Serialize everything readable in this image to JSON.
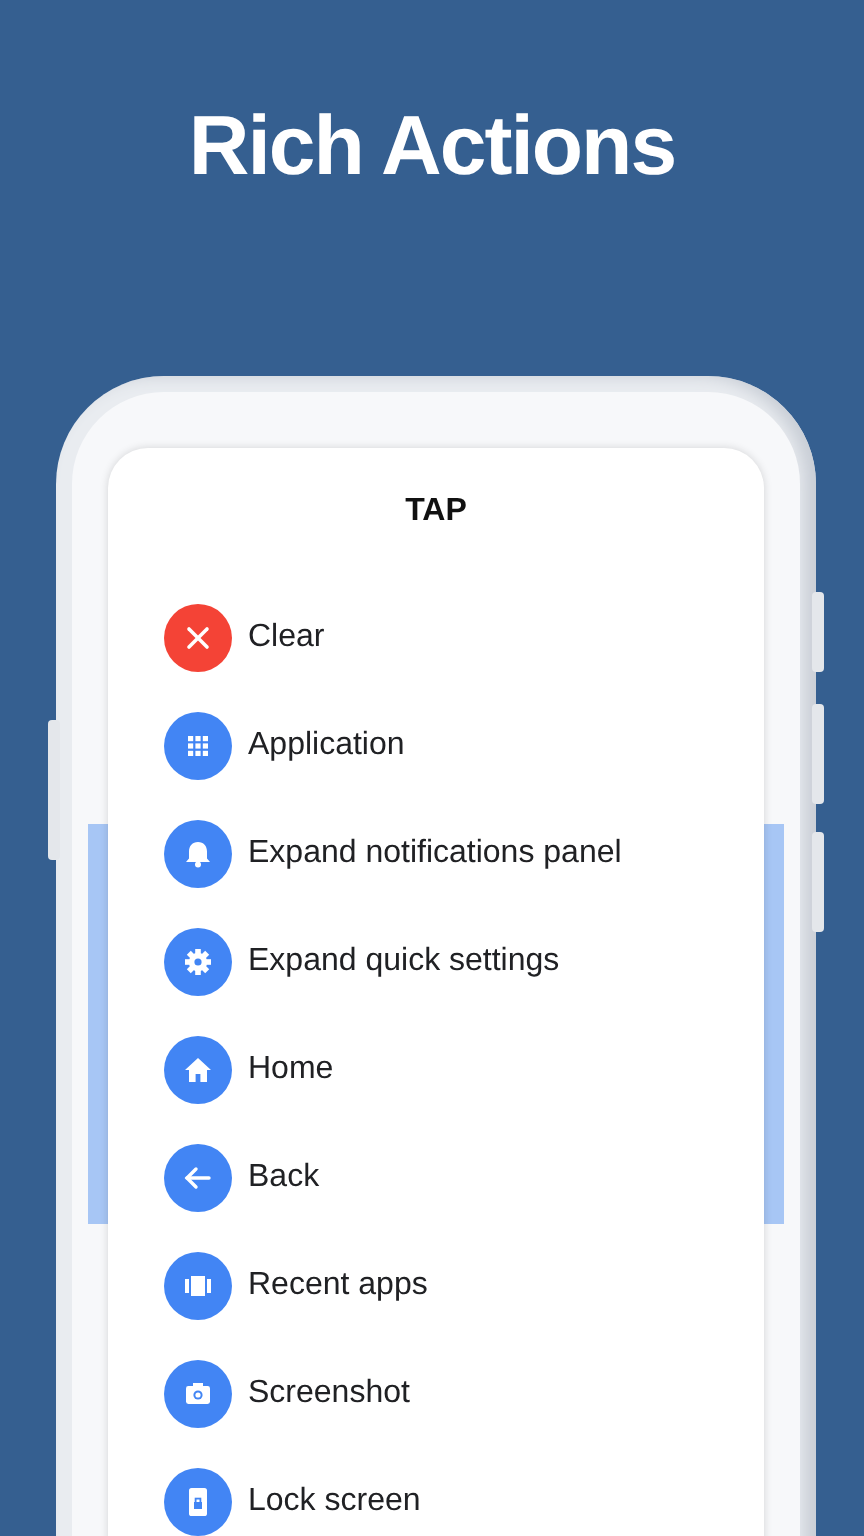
{
  "headline": "Rich Actions",
  "dialog": {
    "title": "TAP",
    "actions": [
      {
        "kind": "close",
        "label": "Clear",
        "color": "#f44336"
      },
      {
        "kind": "apps",
        "label": "Application",
        "color": "#4285f4"
      },
      {
        "kind": "bell",
        "label": "Expand notifications panel",
        "color": "#4285f4"
      },
      {
        "kind": "gear",
        "label": "Expand quick settings",
        "color": "#4285f4"
      },
      {
        "kind": "home",
        "label": "Home",
        "color": "#4285f4"
      },
      {
        "kind": "back",
        "label": "Back",
        "color": "#4285f4"
      },
      {
        "kind": "recent",
        "label": "Recent apps",
        "color": "#4285f4"
      },
      {
        "kind": "camera",
        "label": "Screenshot",
        "color": "#4285f4"
      },
      {
        "kind": "lock",
        "label": "Lock screen",
        "color": "#4285f4"
      }
    ]
  }
}
